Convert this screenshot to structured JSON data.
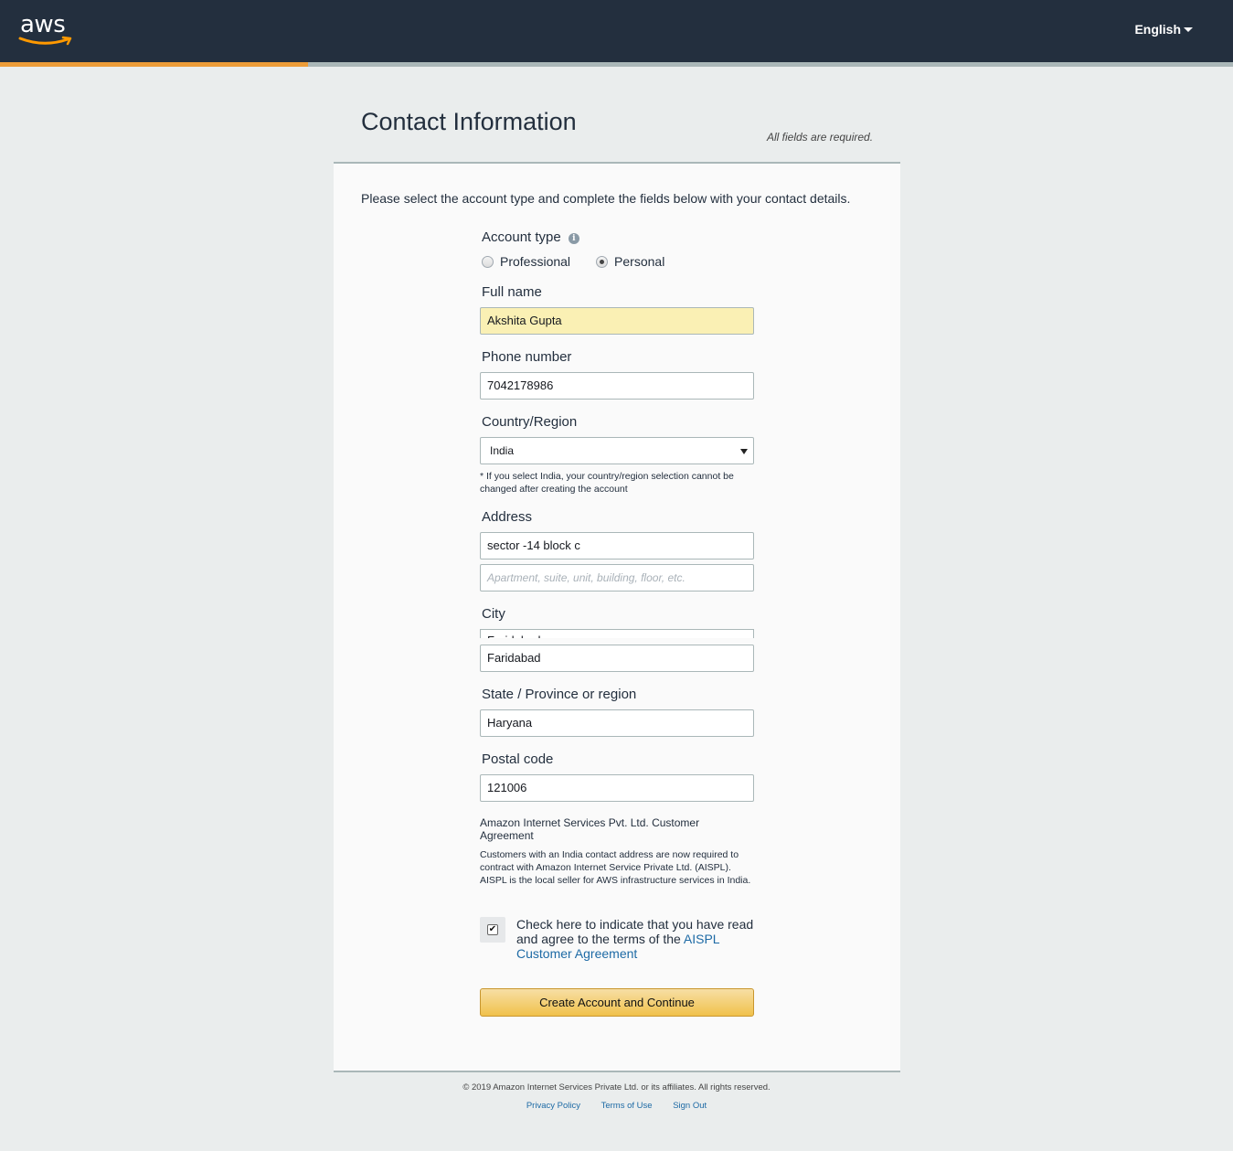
{
  "header": {
    "logo_text": "aws",
    "language": "English",
    "progress": 0.25
  },
  "page": {
    "title": "Contact Information",
    "required_note": "All fields are required.",
    "intro": "Please select the account type and complete the fields below with your contact details."
  },
  "form": {
    "account_type": {
      "label": "Account type",
      "info_icon": "info-icon",
      "options": [
        "Professional",
        "Personal"
      ],
      "selected": "Personal"
    },
    "full_name": {
      "label": "Full name",
      "value": "Akshita Gupta"
    },
    "phone": {
      "label": "Phone number",
      "value": "7042178986"
    },
    "country": {
      "label": "Country/Region",
      "value": "India",
      "note": "* If you select India, your country/region selection cannot be changed after creating the account"
    },
    "address": {
      "label": "Address",
      "line1": "sector -14 block c",
      "line2_placeholder": "Apartment, suite, unit, building, floor, etc."
    },
    "city": {
      "label": "City",
      "value": "Faridabad"
    },
    "state": {
      "label": "State / Province or region",
      "value": "Haryana"
    },
    "postal": {
      "label": "Postal code",
      "value": "121006"
    },
    "agreement": {
      "title": "Amazon Internet Services Pvt. Ltd. Customer Agreement",
      "body": "Customers with an India contact address are now required to contract with Amazon Internet Service Private Ltd. (AISPL). AISPL is the local seller for AWS infrastructure services in India.",
      "checkbox_text": "Check here to indicate that you have read and agree to the terms of the ",
      "checkbox_link": "AISPL Customer Agreement",
      "checked": true
    },
    "submit_label": "Create Account and Continue"
  },
  "footer": {
    "copyright": "© 2019 Amazon Internet Services Private Ltd. or its affiliates. All rights reserved.",
    "links": [
      "Privacy Policy",
      "Terms of Use",
      "Sign Out"
    ]
  },
  "colors": {
    "header_bg": "#232f3e",
    "accent_orange": "#ec9c38",
    "link_blue": "#1d6aa5",
    "autofill_yellow": "#faf0b4"
  }
}
